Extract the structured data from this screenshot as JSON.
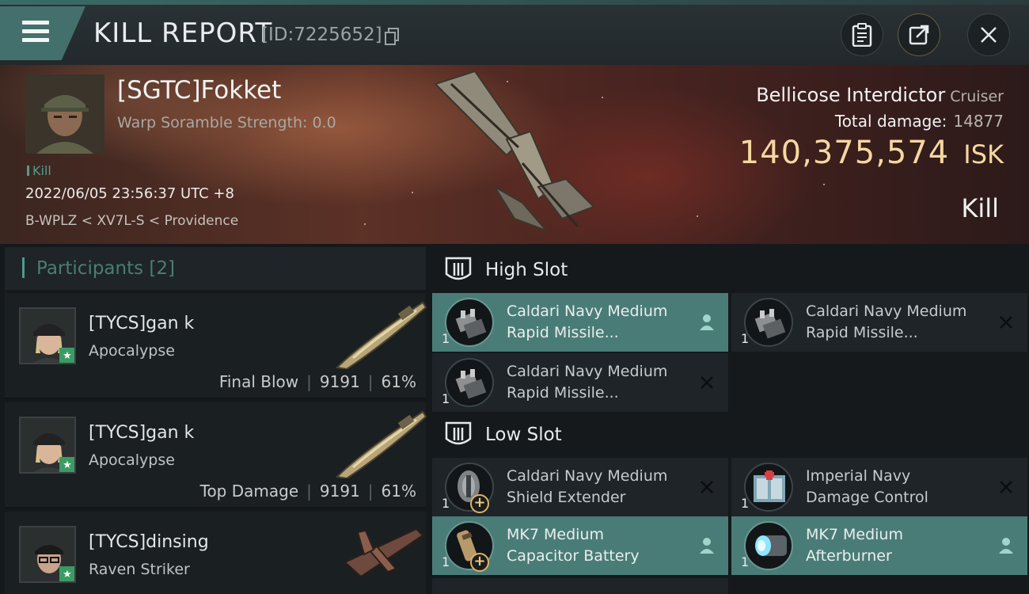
{
  "header": {
    "title": "KILL REPORT",
    "report_id": "[ID:7225652]"
  },
  "victim": {
    "name": "[SGTC]Fokket",
    "scramble": "Warp Soramble Strength: 0.0",
    "tag": "Kill",
    "timestamp": "2022/06/05 23:56:37 UTC +8",
    "location": "B-WPLZ < XV7L-S < Providence",
    "ship": "Bellicose Interdictor",
    "ship_class": "Cruiser",
    "damage_label": "Total damage:",
    "damage_value": "14877",
    "isk_value": "140,375,574",
    "isk_unit": "ISK",
    "result": "Kill"
  },
  "participants": {
    "heading": "Participants [2]",
    "items": [
      {
        "name": "[TYCS]gan k",
        "ship": "Apocalypse",
        "role": "Final Blow",
        "damage": "9191",
        "percent": "61%",
        "sep": "|"
      },
      {
        "name": "[TYCS]gan k",
        "ship": "Apocalypse",
        "role": "Top Damage",
        "damage": "9191",
        "percent": "61%",
        "sep": "|"
      },
      {
        "name": "[TYCS]dinsing",
        "ship": "Raven Striker"
      }
    ]
  },
  "slots": {
    "high": {
      "title": "High Slot",
      "modules": [
        {
          "line1": "Caldari Navy Medium",
          "line2": "Rapid Missile...",
          "qty": "1",
          "status": "dropped",
          "icon": "launcher-icon"
        },
        {
          "line1": "Caldari Navy Medium",
          "line2": "Rapid Missile...",
          "qty": "1",
          "status": "destroyed",
          "icon": "launcher-icon"
        },
        {
          "line1": "Caldari Navy Medium",
          "line2": "Rapid Missile...",
          "qty": "1",
          "status": "destroyed",
          "icon": "launcher-icon"
        }
      ]
    },
    "low": {
      "title": "Low Slot",
      "modules": [
        {
          "line1": "Caldari Navy Medium",
          "line2": "Shield Extender",
          "qty": "1",
          "status": "destroyed",
          "icon": "shield-extender-icon"
        },
        {
          "line1": "Imperial Navy",
          "line2": "Damage Control",
          "qty": "1",
          "status": "destroyed",
          "icon": "damage-control-icon"
        },
        {
          "line1": "MK7 Medium",
          "line2": "Capacitor Battery",
          "qty": "1",
          "status": "dropped",
          "icon": "capacitor-battery-icon"
        },
        {
          "line1": "MK7 Medium",
          "line2": "Afterburner",
          "qty": "1",
          "status": "dropped",
          "icon": "afterburner-icon"
        }
      ]
    }
  },
  "colors": {
    "accent": "#4a7c77",
    "isk": "#f4d8a0",
    "participants_heading": "#4a7d76"
  }
}
